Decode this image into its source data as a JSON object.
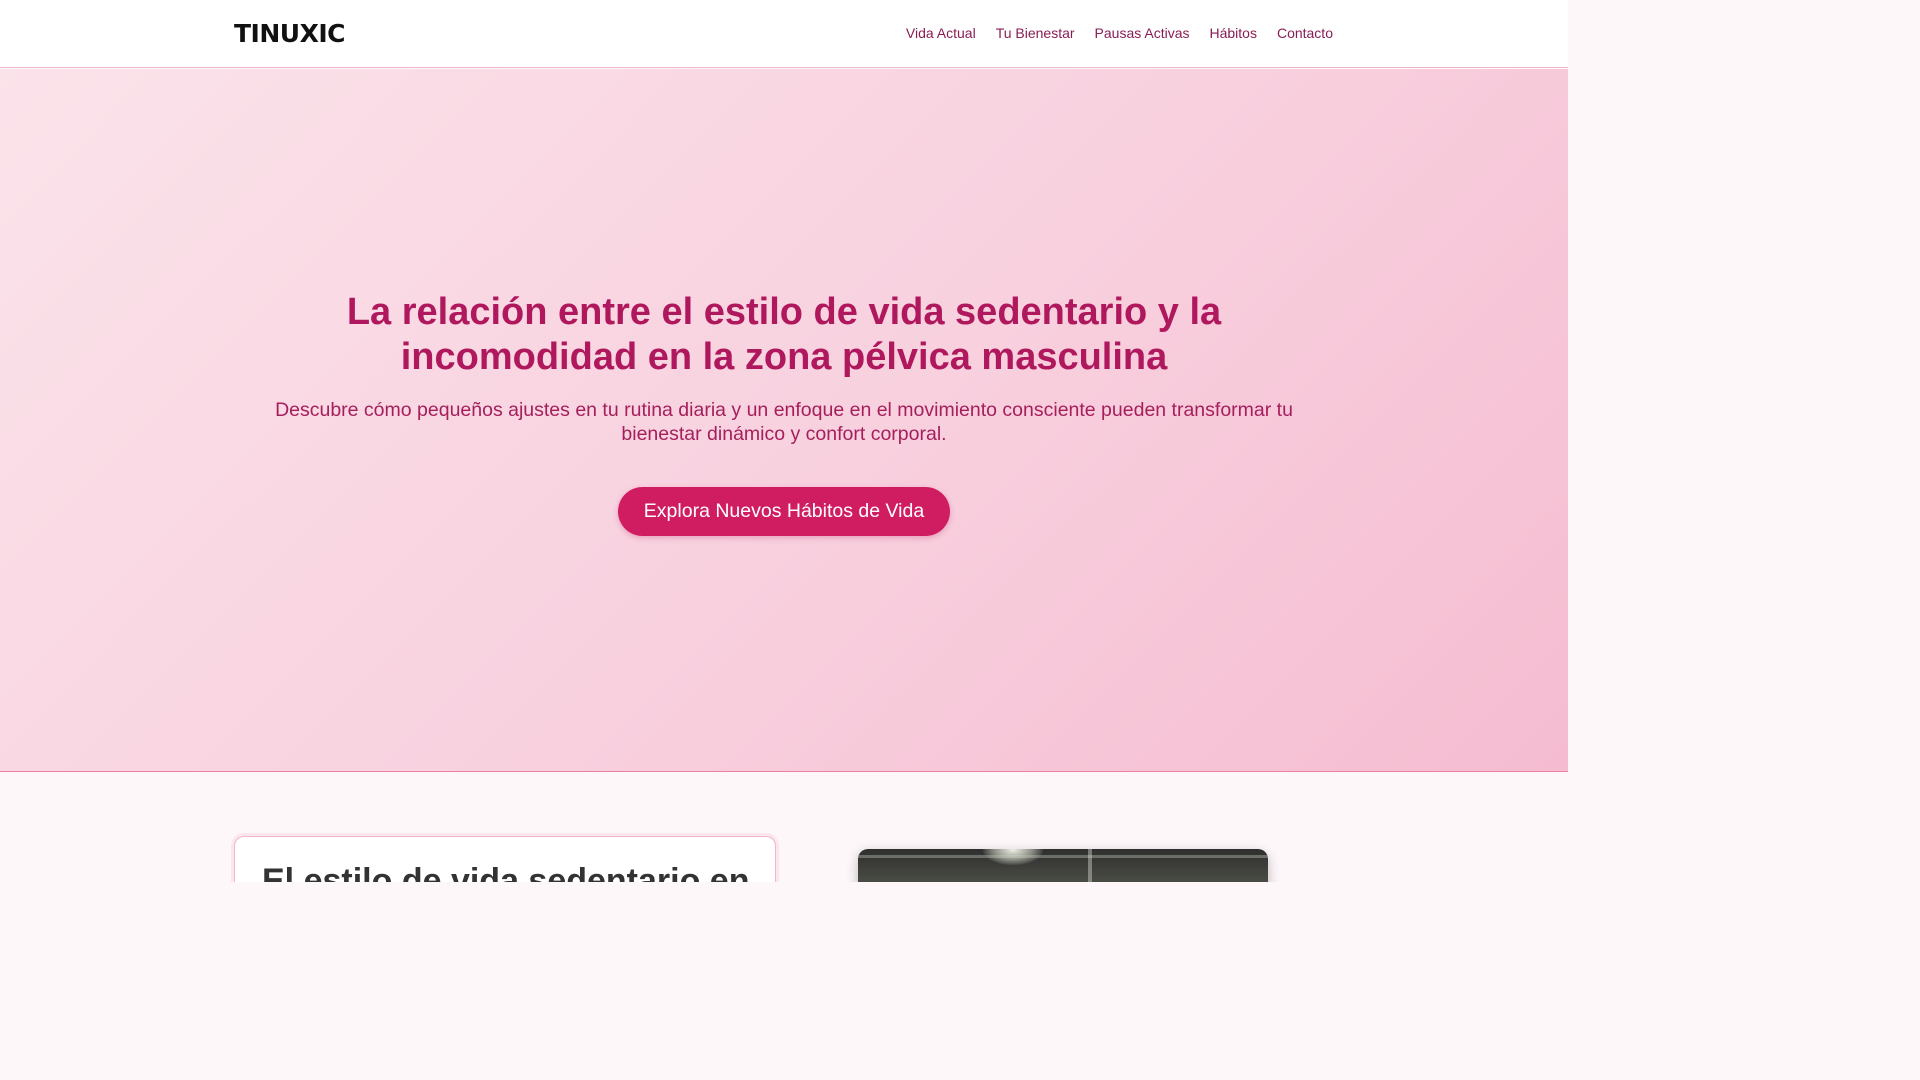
{
  "header": {
    "logo": "TINUXIC",
    "nav": [
      {
        "label": "Vida Actual"
      },
      {
        "label": "Tu Bienestar"
      },
      {
        "label": "Pausas Activas"
      },
      {
        "label": "Hábitos"
      },
      {
        "label": "Contacto"
      }
    ]
  },
  "hero": {
    "title": "La relación entre el estilo de vida sedentario y la incomodidad en la zona pélvica masculina",
    "subtitle": "Descubre cómo pequeños ajustes en tu rutina diaria y un enfoque en el movimiento consciente pueden transformar tu bienestar dinámico y confort corporal.",
    "cta_label": "Explora Nuevos Hábitos de Vida"
  },
  "section": {
    "card_heading": "El estilo de vida sedentario en"
  },
  "colors": {
    "accent": "#d01d61",
    "title": "#b0185d",
    "nav_link": "#8a1d54",
    "hero_bg_start": "#fbe3ea",
    "hero_bg_end": "#f5bcd1"
  }
}
